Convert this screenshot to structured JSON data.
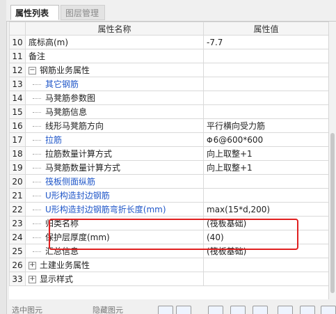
{
  "tabs": [
    {
      "label": "属性列表"
    },
    {
      "label": "图层管理"
    }
  ],
  "table": {
    "headers": {
      "name": "属性名称",
      "value": "属性值"
    },
    "rows": [
      {
        "num": "10",
        "name": "底标高(m)",
        "value": "-7.7"
      },
      {
        "num": "11",
        "name": "备注",
        "value": ""
      },
      {
        "num": "12",
        "name": "钢筋业务属性",
        "value": ""
      },
      {
        "num": "13",
        "name": "其它钢筋",
        "value": ""
      },
      {
        "num": "14",
        "name": "马凳筋参数图",
        "value": ""
      },
      {
        "num": "15",
        "name": "马凳筋信息",
        "value": ""
      },
      {
        "num": "16",
        "name": "线形马凳筋方向",
        "value": "平行横向受力筋"
      },
      {
        "num": "17",
        "name": "拉筋",
        "value": "6@600*600",
        "value_prefix": "Φ"
      },
      {
        "num": "18",
        "name": "拉筋数量计算方式",
        "value": "向上取整+1"
      },
      {
        "num": "19",
        "name": "马凳筋数量计算方式",
        "value": "向上取整+1"
      },
      {
        "num": "20",
        "name": "筏板侧面纵筋",
        "value": ""
      },
      {
        "num": "21",
        "name": "U形构造封边钢筋",
        "value": ""
      },
      {
        "num": "22",
        "name": "U形构造封边钢筋弯折长度(mm)",
        "value": "max(15*d,200)"
      },
      {
        "num": "23",
        "name": "归类名称",
        "value": "(筏板基础)"
      },
      {
        "num": "24",
        "name": "保护层厚度(mm)",
        "value": "(40)"
      },
      {
        "num": "25",
        "name": "汇总信息",
        "value": "(筏板基础)"
      },
      {
        "num": "26",
        "name": "土建业务属性",
        "value": ""
      },
      {
        "num": "33",
        "name": "显示样式",
        "value": ""
      }
    ]
  },
  "expanders": {
    "collapse": "−",
    "expand": "+"
  },
  "colors": {
    "link_blue": "#1f56c8",
    "highlight_red": "#e02020"
  },
  "bottom_bar": {
    "left_text": "选中图元",
    "right_text": "隐藏图元"
  }
}
